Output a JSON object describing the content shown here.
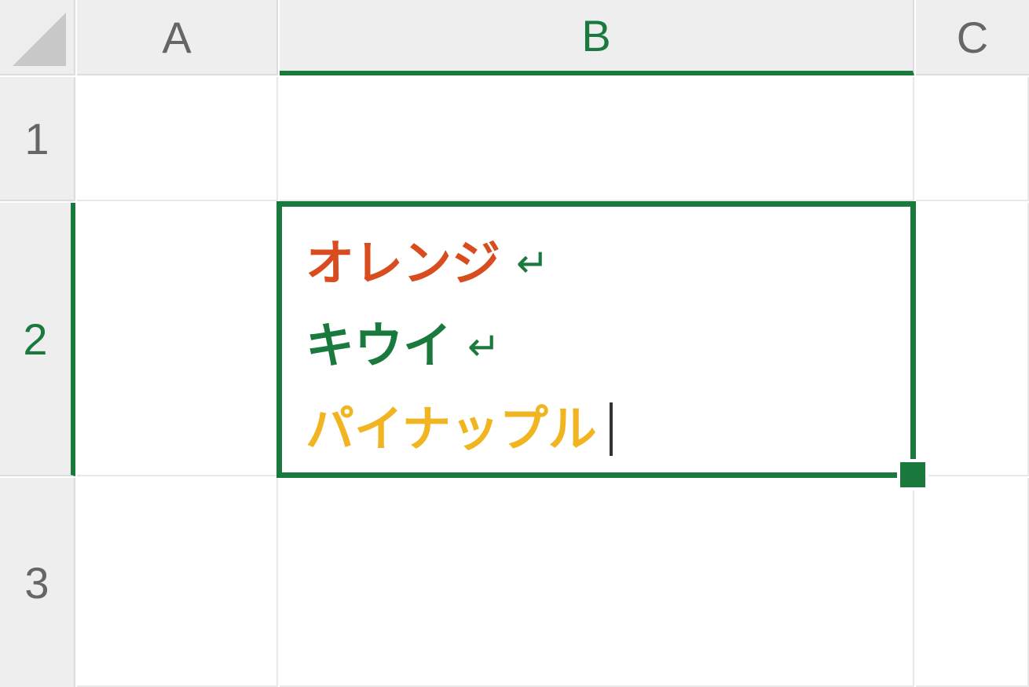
{
  "columns": {
    "a": "A",
    "b": "B",
    "c": "C"
  },
  "rows": {
    "r1": "1",
    "r2": "2",
    "r3": "3"
  },
  "active_cell": {
    "address": "B2",
    "lines": [
      {
        "text": "オレンジ",
        "color": "#d84c1f",
        "has_linebreak": true
      },
      {
        "text": "キウイ",
        "color": "#1a7a3e",
        "has_linebreak": true
      },
      {
        "text": "パイナップル",
        "color": "#f0b520",
        "has_linebreak": false
      }
    ],
    "line1_text": "オレンジ",
    "line2_text": "キウイ",
    "line3_text": "パイナップル"
  },
  "selection_color": "#1a7a3e"
}
